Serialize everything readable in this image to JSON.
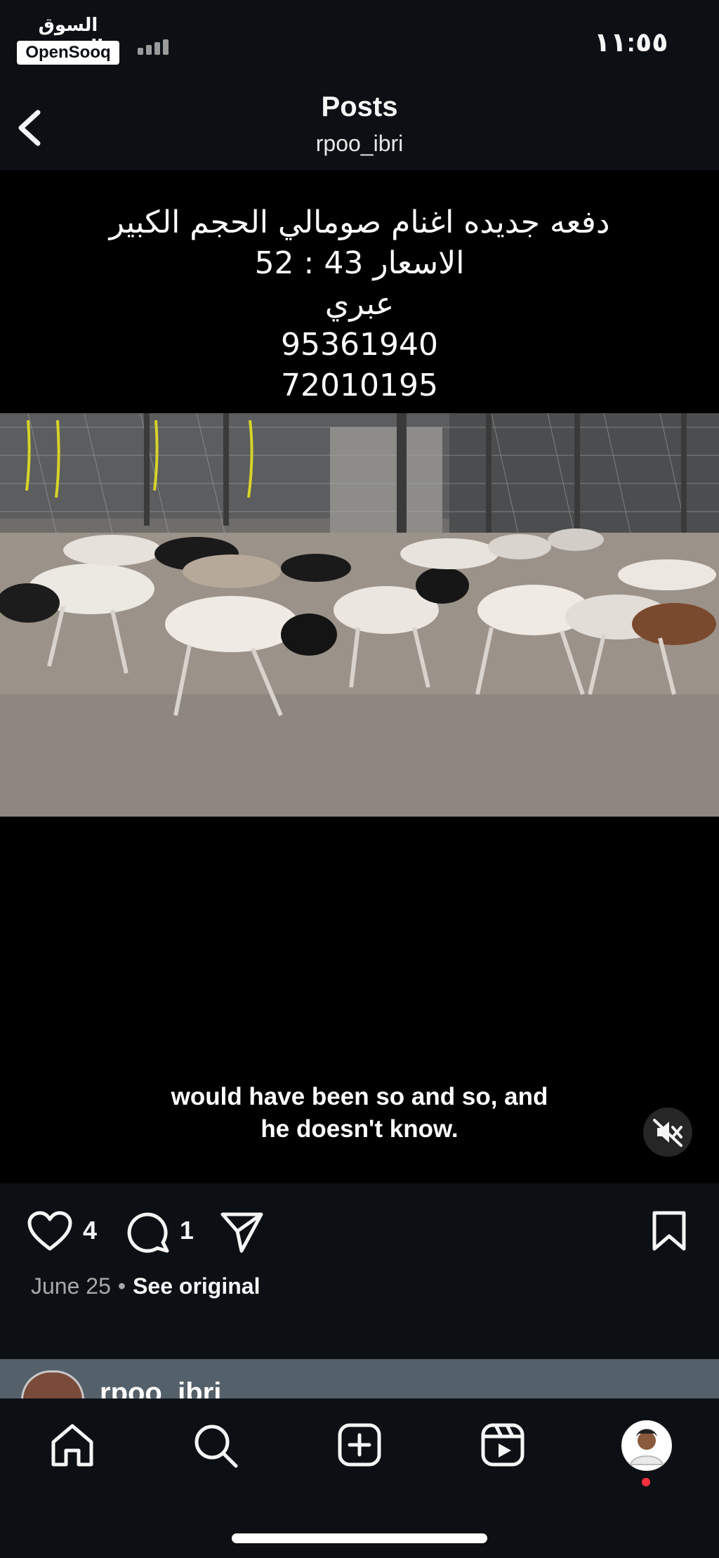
{
  "status_bar": {
    "watermark_arabic": "السوق المفتوح",
    "watermark_brand": "OpenSooq",
    "time": "١١:٥٥"
  },
  "header": {
    "title": "Posts",
    "username": "rpoo_ibri"
  },
  "post": {
    "caption_lines": [
      "دفعه جديده اغنام صومالي الحجم الكبير",
      "الاسعار 43 : 52",
      "عبري",
      "95361940",
      "72010195"
    ],
    "video_subtitle_lines": [
      "would have been so and so, and",
      "he doesn't know."
    ],
    "likes_count": "4",
    "comments_count": "1",
    "date": "June 25",
    "separator": "•",
    "see_original_label": "See original"
  },
  "next_post": {
    "username": "rpoo_ibri"
  },
  "icons": {
    "back": "chevron-left-icon",
    "mute": "speaker-muted-icon",
    "like": "heart-icon",
    "comment": "comment-bubble-icon",
    "share": "paper-plane-icon",
    "save": "bookmark-icon",
    "home": "home-icon",
    "search": "search-icon",
    "create": "plus-square-icon",
    "reels": "reels-icon",
    "profile": "avatar"
  },
  "colors": {
    "background": "#0c1014",
    "media_background": "#000000",
    "notification_dot": "#ff3040",
    "secondary_text": "#a8a8a8"
  }
}
